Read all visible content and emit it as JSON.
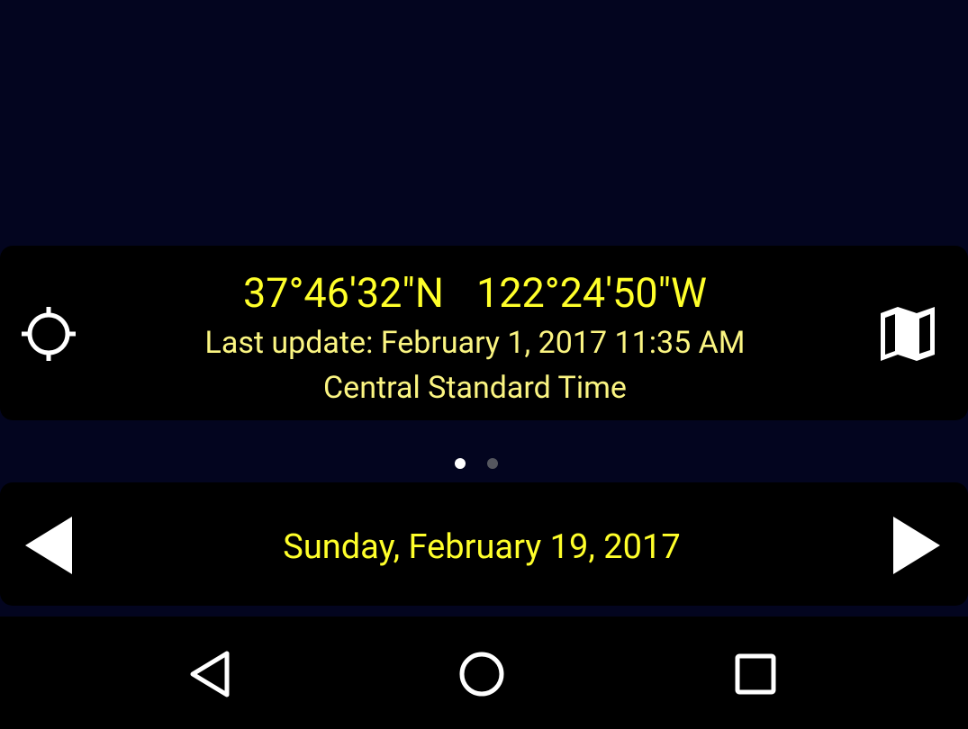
{
  "location": {
    "latitude": "37°46'32\"N",
    "longitude": "122°24'50\"W",
    "last_update": "Last update: February 1, 2017 11:35 AM",
    "timezone": "Central Standard Time",
    "locate_icon": "crosshair-gps-icon",
    "map_icon": "folded-map-icon"
  },
  "pager": {
    "pages": 2,
    "active_index": 0
  },
  "date_selector": {
    "date": "Sunday, February 19, 2017",
    "prev_icon": "triangle-left-icon",
    "next_icon": "triangle-right-icon"
  },
  "navigation_bar": {
    "back_icon": "back-triangle-icon",
    "home_icon": "home-circle-icon",
    "recents_icon": "recents-square-icon"
  },
  "colors": {
    "background": "#03051f",
    "card": "#000000",
    "accent_yellow": "#ffff2a",
    "soft_yellow": "#fbf582",
    "icon_white": "#ffffff"
  }
}
